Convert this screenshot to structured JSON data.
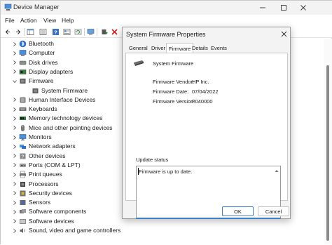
{
  "window": {
    "title": "Device Manager",
    "menu": [
      "File",
      "Action",
      "View",
      "Help"
    ],
    "toolbar": [
      "back-icon",
      "forward-icon",
      "properties-grid-icon",
      "list-icon",
      "help-icon",
      "details-icon",
      "refresh-icon",
      "scan-hardware-icon",
      "update-driver-icon",
      "uninstall-icon",
      "download-icon"
    ]
  },
  "tree": {
    "items": [
      {
        "label": "Bluetooth",
        "icon": "bluetooth-icon",
        "expanded": false,
        "indent": 0
      },
      {
        "label": "Computer",
        "icon": "computer-icon",
        "expanded": false,
        "indent": 0
      },
      {
        "label": "Disk drives",
        "icon": "disk-drive-icon",
        "expanded": false,
        "indent": 0
      },
      {
        "label": "Display adapters",
        "icon": "display-adapter-icon",
        "expanded": false,
        "indent": 0
      },
      {
        "label": "Firmware",
        "icon": "firmware-icon",
        "expanded": true,
        "indent": 0
      },
      {
        "label": "System Firmware",
        "icon": "firmware-chip-icon",
        "expanded": null,
        "indent": 1
      },
      {
        "label": "Human Interface Devices",
        "icon": "hid-icon",
        "expanded": false,
        "indent": 0
      },
      {
        "label": "Keyboards",
        "icon": "keyboard-icon",
        "expanded": false,
        "indent": 0
      },
      {
        "label": "Memory technology devices",
        "icon": "memory-icon",
        "expanded": false,
        "indent": 0
      },
      {
        "label": "Mice and other pointing devices",
        "icon": "mouse-icon",
        "expanded": false,
        "indent": 0
      },
      {
        "label": "Monitors",
        "icon": "monitor-icon",
        "expanded": false,
        "indent": 0
      },
      {
        "label": "Network adapters",
        "icon": "network-icon",
        "expanded": false,
        "indent": 0
      },
      {
        "label": "Other devices",
        "icon": "other-devices-icon",
        "expanded": false,
        "indent": 0
      },
      {
        "label": "Ports (COM & LPT)",
        "icon": "ports-icon",
        "expanded": false,
        "indent": 0
      },
      {
        "label": "Print queues",
        "icon": "printer-icon",
        "expanded": false,
        "indent": 0
      },
      {
        "label": "Processors",
        "icon": "processor-icon",
        "expanded": false,
        "indent": 0
      },
      {
        "label": "Security devices",
        "icon": "security-icon",
        "expanded": false,
        "indent": 0
      },
      {
        "label": "Sensors",
        "icon": "sensor-icon",
        "expanded": false,
        "indent": 0
      },
      {
        "label": "Software components",
        "icon": "software-component-icon",
        "expanded": false,
        "indent": 0
      },
      {
        "label": "Software devices",
        "icon": "software-device-icon",
        "expanded": false,
        "indent": 0
      },
      {
        "label": "Sound, video and game controllers",
        "icon": "sound-icon",
        "expanded": false,
        "indent": 0
      }
    ]
  },
  "dialog": {
    "title": "System Firmware Properties",
    "tabs": [
      "General",
      "Driver",
      "Firmware",
      "Details",
      "Events"
    ],
    "active_tab": "Firmware",
    "device_name": "System Firmware",
    "props": [
      {
        "label": "Firmware Vendor:",
        "value": "HP Inc."
      },
      {
        "label": "Firmware Date:",
        "value": "07/04/2022"
      },
      {
        "label": "Firmware Version:",
        "value": "F040000"
      }
    ],
    "status_label": "Update status",
    "status_text": "Firmware is up to date.",
    "ok_label": "OK",
    "cancel_label": "Cancel"
  },
  "colors": {
    "accent": "#3b7fd1",
    "titlebar": "#f3f3f3",
    "uninstall_red": "#d42020",
    "update_green": "#2a8a3a"
  }
}
